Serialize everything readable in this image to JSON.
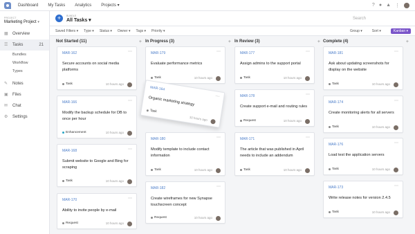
{
  "nav": {
    "links": [
      "Dashboard",
      "My Tasks",
      "Analytics",
      "Projects ▾"
    ]
  },
  "project": {
    "caption": "PROJECT",
    "name": "Marketing Project"
  },
  "sidebar": {
    "items": [
      {
        "label": "Overview",
        "icon": "overview-icon"
      },
      {
        "label": "Tasks",
        "count": "21",
        "icon": "tasks-icon"
      },
      {
        "label": "Notes",
        "icon": "notes-icon"
      },
      {
        "label": "Files",
        "icon": "files-icon"
      },
      {
        "label": "Chat",
        "icon": "chat-icon"
      },
      {
        "label": "Settings",
        "icon": "settings-icon"
      }
    ],
    "subitems": [
      "Bundles",
      "Workflow",
      "Types"
    ]
  },
  "board": {
    "caption": "BUNDLE",
    "name": "All Tasks ▾",
    "search_placeholder": "Search"
  },
  "filters": {
    "items": [
      "Saved Filters ▾",
      "Type ▾",
      "Status ▾",
      "Owner ▾",
      "Tags ▾",
      "Priority ▾"
    ],
    "group": "Group ▾",
    "sort": "Sort ▾",
    "view": "Kanban ▾"
  },
  "columns": [
    {
      "title": "Not Started (11)"
    },
    {
      "title": "In Progress (3)"
    },
    {
      "title": "In Review (3)"
    },
    {
      "title": "Complete (4)"
    }
  ],
  "cards": [
    {
      "id": "MAR-162",
      "title": "Secure accounts on social media platforms",
      "type": "Task",
      "time": "10 hours ago"
    },
    {
      "id": "MAR-166",
      "title": "Modify the backup schedule for DB to once per hour",
      "type": "Enhancement",
      "time": "10 hours ago"
    },
    {
      "id": "MAR-168",
      "title": "Submit website to Google and Bing for scraping",
      "type": "Task",
      "time": "10 hours ago"
    },
    {
      "id": "MAR-170",
      "title": "Ability to invite people by e-mail",
      "type": "Request",
      "time": "10 hours ago"
    },
    {
      "id": "MAR-179",
      "title": "Evaluate performance metrics",
      "type": "Task",
      "time": "10 hours ago"
    },
    {
      "id": "MAR-164",
      "title": "Organic marketing strategy",
      "type": "Task",
      "time": "10 hours ago"
    },
    {
      "id": "MAR-180",
      "title": "Modify template to include contact information",
      "type": "Task",
      "time": "10 hours ago"
    },
    {
      "id": "MAR-182",
      "title": "Create wireframes for new Synapse touchscreen concept",
      "type": "Request",
      "time": "10 hours ago"
    },
    {
      "id": "MAR-177",
      "title": "Assign admins to the support portal",
      "type": "Task",
      "time": "10 hours ago"
    },
    {
      "id": "MAR-178",
      "title": "Create support e-mail and routing rules",
      "type": "Request",
      "time": "10 hours ago"
    },
    {
      "id": "MAR-171",
      "title": "The article that was published in April needs to include an addendum",
      "type": "Task",
      "time": "10 hours ago"
    },
    {
      "id": "MAR-181",
      "title": "Ask about updating screenshots for display on the website",
      "type": "Task",
      "time": "10 hours ago"
    },
    {
      "id": "MAR-174",
      "title": "Create monitoring alerts for all servers",
      "type": "Task",
      "time": "10 hours ago"
    },
    {
      "id": "MAR-176",
      "title": "Load test the application servers",
      "type": "Task",
      "time": "10 hours ago"
    },
    {
      "id": "MAR-173",
      "title": "Write release notes for version 2.4.5",
      "type": "Task",
      "time": "10 hours ago"
    }
  ],
  "colors": {
    "accent": "#2f6fcf",
    "kanban": "#7a55c9",
    "id_link": "#4a7cc9",
    "enhancement": "#2aa5c4",
    "request": "#555555",
    "task": "#555555"
  }
}
